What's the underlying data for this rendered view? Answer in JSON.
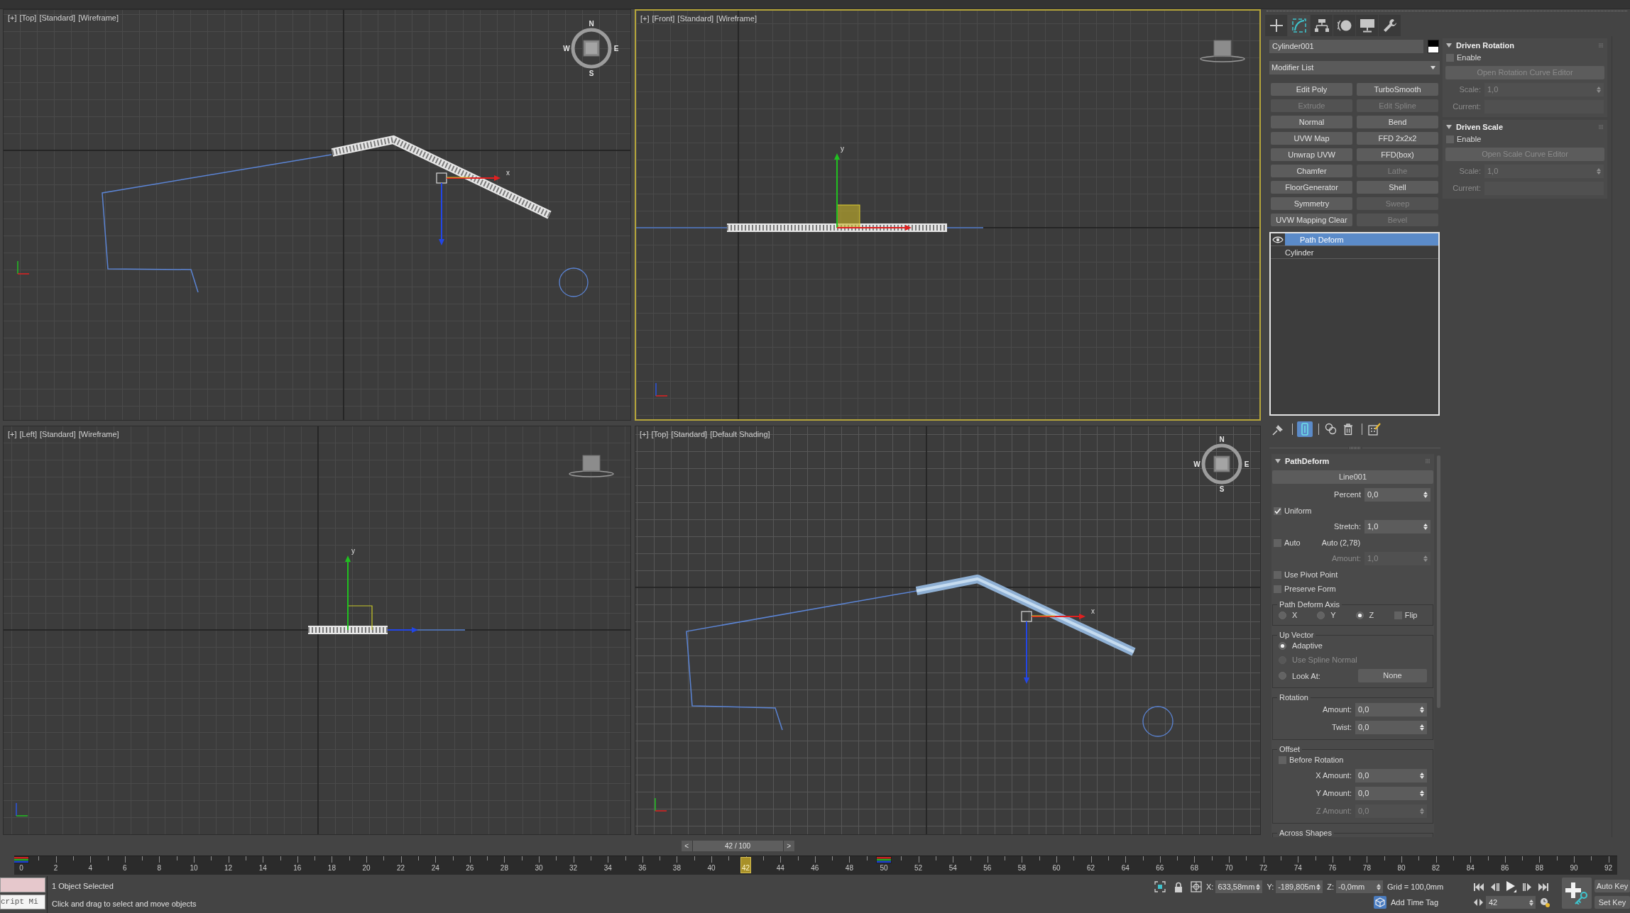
{
  "viewports": [
    {
      "kind": "top",
      "active": false,
      "label": [
        "[+]",
        "[Top]",
        "[Standard]",
        "[Wireframe]"
      ],
      "axis_labels": [
        "x"
      ],
      "compass": [
        "N",
        "E",
        "S",
        "W"
      ]
    },
    {
      "kind": "front",
      "active": true,
      "label": [
        "[+]",
        "[Front]",
        "[Standard]",
        "[Wireframe]"
      ],
      "axis_labels": [
        "y"
      ]
    },
    {
      "kind": "left",
      "active": false,
      "label": [
        "[+]",
        "[Left]",
        "[Standard]",
        "[Wireframe]"
      ],
      "axis_labels": [
        "y"
      ]
    },
    {
      "kind": "top_shaded",
      "active": false,
      "label": [
        "[+]",
        "[Top]",
        "[Standard]",
        "[Default Shading]"
      ],
      "axis_labels": [
        "x"
      ],
      "compass": [
        "N",
        "E",
        "S",
        "W"
      ]
    }
  ],
  "command_panel": {
    "tabs": [
      {
        "kind": "create",
        "selected": false
      },
      {
        "kind": "modify",
        "selected": true
      },
      {
        "kind": "hierarchy",
        "selected": false
      },
      {
        "kind": "motion",
        "selected": false
      },
      {
        "kind": "display",
        "selected": false
      },
      {
        "kind": "utilities",
        "selected": false
      }
    ],
    "object_name": "Cylinder001",
    "modifier_list": "Modifier List",
    "modifier_buttons": [
      {
        "label": "Edit Poly",
        "disabled": false
      },
      {
        "label": "TurboSmooth",
        "disabled": false
      },
      {
        "label": "Extrude",
        "disabled": true
      },
      {
        "label": "Edit Spline",
        "disabled": true
      },
      {
        "label": "Normal",
        "disabled": false
      },
      {
        "label": "Bend",
        "disabled": false
      },
      {
        "label": "UVW Map",
        "disabled": false
      },
      {
        "label": "FFD 2x2x2",
        "disabled": false
      },
      {
        "label": "Unwrap UVW",
        "disabled": false
      },
      {
        "label": "FFD(box)",
        "disabled": false
      },
      {
        "label": "Chamfer",
        "disabled": false
      },
      {
        "label": "Lathe",
        "disabled": true
      },
      {
        "label": "FloorGenerator",
        "disabled": false
      },
      {
        "label": "Shell",
        "disabled": false
      },
      {
        "label": "Symmetry",
        "disabled": false
      },
      {
        "label": "Sweep",
        "disabled": true
      },
      {
        "label": "UVW Mapping Clear",
        "disabled": false
      },
      {
        "label": "Bevel",
        "disabled": true
      }
    ],
    "stack": [
      {
        "kind": "modifier",
        "label": "Path Deform",
        "selected": true
      },
      {
        "kind": "base",
        "label": "Cylinder",
        "selected": false
      }
    ],
    "stack_tools": [
      {
        "kind": "pin",
        "on": false
      },
      {
        "kind": "end_result",
        "on": true
      },
      {
        "kind": "make_unique",
        "on": false
      },
      {
        "kind": "remove",
        "on": false
      },
      {
        "kind": "configure",
        "on": false
      }
    ],
    "rollout": {
      "title": "PathDeform",
      "expanded": true,
      "controls": [
        {
          "kind": "pick_button",
          "label": "Line001"
        },
        {
          "kind": "spinner",
          "label": "Percent",
          "value": "0,0",
          "disabled": false
        },
        {
          "kind": "checkbox",
          "label": "Uniform",
          "checked": true,
          "disabled": false
        },
        {
          "kind": "spinner",
          "label": "Stretch:",
          "value": "1,0",
          "disabled": false
        },
        {
          "kind": "checkbox",
          "label": "Auto",
          "checked": false,
          "disabled": false,
          "note": "Auto (2,78)"
        },
        {
          "kind": "spinner",
          "label": "Amount:",
          "value": "1,0",
          "disabled": true
        },
        {
          "kind": "checkbox",
          "label": "Use Pivot Point",
          "checked": false,
          "disabled": false
        },
        {
          "kind": "checkbox",
          "label": "Preserve Form",
          "checked": false,
          "disabled": false
        }
      ],
      "groups": [
        {
          "title": "Path Deform Axis",
          "kind": "row",
          "items": [
            {
              "kind": "radio",
              "label": "X",
              "selected": false,
              "disabled": false
            },
            {
              "kind": "radio",
              "label": "Y",
              "selected": false,
              "disabled": false
            },
            {
              "kind": "radio",
              "label": "Z",
              "selected": true,
              "disabled": false
            },
            {
              "kind": "checkbox",
              "label": "Flip",
              "checked": false,
              "disabled": false
            }
          ]
        },
        {
          "title": "Up Vector",
          "kind": "column",
          "items": [
            {
              "kind": "radio",
              "label": "Adaptive",
              "selected": true,
              "disabled": false
            },
            {
              "kind": "radio",
              "label": "Use Spline Normal",
              "selected": false,
              "disabled": true
            },
            {
              "kind": "radio",
              "label": "Look At:",
              "selected": false,
              "disabled": false,
              "button": "None"
            }
          ]
        },
        {
          "title": "Rotation",
          "kind": "column",
          "items": [
            {
              "kind": "spinner",
              "label": "Amount:",
              "value": "0,0",
              "disabled": false
            },
            {
              "kind": "spinner",
              "label": "Twist:",
              "value": "0,0",
              "disabled": false
            }
          ]
        },
        {
          "title": "Offset",
          "kind": "column",
          "items": [
            {
              "kind": "checkbox",
              "label": "Before Rotation",
              "checked": false,
              "disabled": false
            },
            {
              "kind": "spinner",
              "label": "X Amount:",
              "value": "0,0",
              "disabled": false
            },
            {
              "kind": "spinner",
              "label": "Y Amount:",
              "value": "0,0",
              "disabled": false
            },
            {
              "kind": "spinner",
              "label": "Z Amount:",
              "value": "0,0",
              "disabled": true
            }
          ]
        },
        {
          "title": "Across Shapes"
        }
      ]
    },
    "side_rollouts": [
      {
        "title": "Driven Rotation",
        "expanded": true,
        "controls": [
          {
            "kind": "checkbox",
            "label": "Enable",
            "checked": false,
            "disabled": false
          },
          {
            "kind": "wide_button",
            "label": "Open Rotation Curve Editor",
            "disabled": true
          },
          {
            "kind": "spinner",
            "label": "Scale:",
            "value": "1,0",
            "disabled": true
          },
          {
            "kind": "field",
            "label": "Current:",
            "disabled": true
          }
        ]
      },
      {
        "title": "Driven Scale",
        "expanded": true,
        "controls": [
          {
            "kind": "checkbox",
            "label": "Enable",
            "checked": false,
            "disabled": false
          },
          {
            "kind": "wide_button",
            "label": "Open Scale Curve Editor",
            "disabled": true
          },
          {
            "kind": "spinner",
            "label": "Scale:",
            "value": "1,0",
            "disabled": true
          },
          {
            "kind": "field",
            "label": "Current:",
            "disabled": true
          }
        ]
      }
    ]
  },
  "time_slider": {
    "prev": "<",
    "label": "42 / 100",
    "next": ">"
  },
  "timeline": {
    "ticks": [
      {
        "label": "0",
        "key": true,
        "current": false
      },
      {
        "label": "2",
        "key": false,
        "current": false
      },
      {
        "label": "4",
        "key": false,
        "current": false
      },
      {
        "label": "6",
        "key": false,
        "current": false
      },
      {
        "label": "8",
        "key": false,
        "current": false
      },
      {
        "label": "10",
        "key": false,
        "current": false
      },
      {
        "label": "12",
        "key": false,
        "current": false
      },
      {
        "label": "14",
        "key": false,
        "current": false
      },
      {
        "label": "16",
        "key": false,
        "current": false
      },
      {
        "label": "18",
        "key": false,
        "current": false
      },
      {
        "label": "20",
        "key": false,
        "current": false
      },
      {
        "label": "22",
        "key": false,
        "current": false
      },
      {
        "label": "24",
        "key": false,
        "current": false
      },
      {
        "label": "26",
        "key": false,
        "current": false
      },
      {
        "label": "28",
        "key": false,
        "current": false
      },
      {
        "label": "30",
        "key": false,
        "current": false
      },
      {
        "label": "32",
        "key": false,
        "current": false
      },
      {
        "label": "34",
        "key": false,
        "current": false
      },
      {
        "label": "36",
        "key": false,
        "current": false
      },
      {
        "label": "38",
        "key": false,
        "current": false
      },
      {
        "label": "40",
        "key": false,
        "current": false
      },
      {
        "label": "42",
        "key": false,
        "current": true
      },
      {
        "label": "44",
        "key": false,
        "current": false
      },
      {
        "label": "46",
        "key": false,
        "current": false
      },
      {
        "label": "48",
        "key": false,
        "current": false
      },
      {
        "label": "50",
        "key": true,
        "current": false
      },
      {
        "label": "52",
        "key": false,
        "current": false
      },
      {
        "label": "54",
        "key": false,
        "current": false
      },
      {
        "label": "56",
        "key": false,
        "current": false
      },
      {
        "label": "58",
        "key": false,
        "current": false
      },
      {
        "label": "60",
        "key": false,
        "current": false
      },
      {
        "label": "62",
        "key": false,
        "current": false
      },
      {
        "label": "64",
        "key": false,
        "current": false
      },
      {
        "label": "66",
        "key": false,
        "current": false
      },
      {
        "label": "68",
        "key": false,
        "current": false
      },
      {
        "label": "70",
        "key": false,
        "current": false
      },
      {
        "label": "72",
        "key": false,
        "current": false
      },
      {
        "label": "74",
        "key": false,
        "current": false
      },
      {
        "label": "76",
        "key": false,
        "current": false
      },
      {
        "label": "78",
        "key": false,
        "current": false
      },
      {
        "label": "80",
        "key": false,
        "current": false
      },
      {
        "label": "82",
        "key": false,
        "current": false
      },
      {
        "label": "84",
        "key": false,
        "current": false
      },
      {
        "label": "86",
        "key": false,
        "current": false
      },
      {
        "label": "88",
        "key": false,
        "current": false
      },
      {
        "label": "90",
        "key": false,
        "current": false
      },
      {
        "label": "92",
        "key": false,
        "current": false
      }
    ]
  },
  "status_bar": {
    "listener": "cript Mi",
    "selection": "1 Object Selected",
    "prompt": "Click and drag to select and move objects",
    "coords": [
      {
        "label": "X:",
        "value": "633,58mm"
      },
      {
        "label": "Y:",
        "value": "-189,805m"
      },
      {
        "label": "Z:",
        "value": "-0,0mm"
      }
    ],
    "grid": "Grid = 100,0mm",
    "time_tag": "Add Time Tag",
    "frame": "42",
    "auto_key": "Auto Key",
    "set_key": "Set Key"
  }
}
